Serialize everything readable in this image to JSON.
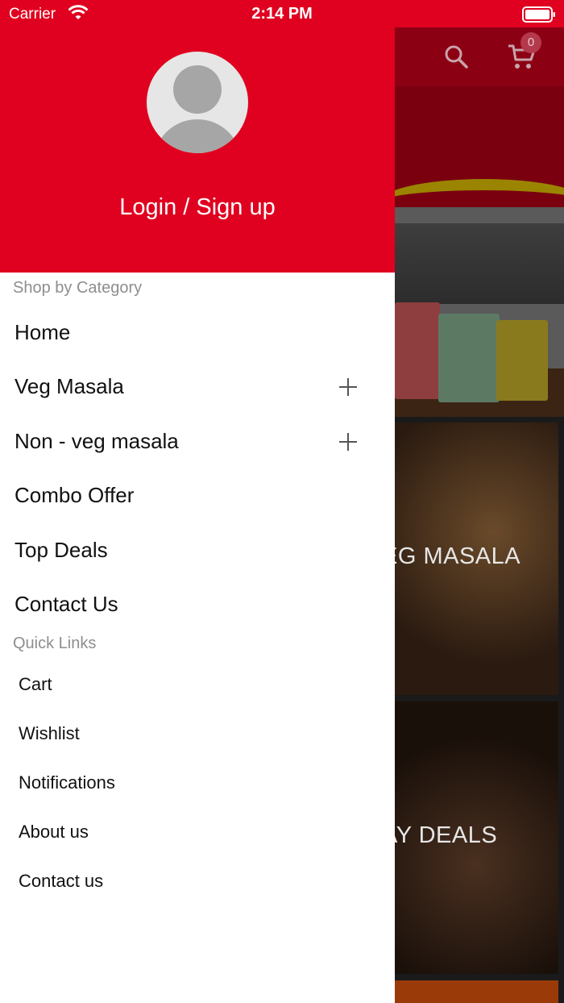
{
  "status_bar": {
    "carrier": "Carrier",
    "time": "2:14 PM"
  },
  "drawer": {
    "login_label": "Login / Sign up",
    "shop_section": "Shop by Category",
    "categories": [
      {
        "label": "Home",
        "expandable": false
      },
      {
        "label": "Veg Masala",
        "expandable": true
      },
      {
        "label": "Non - veg masala",
        "expandable": true
      },
      {
        "label": "Combo Offer",
        "expandable": false
      },
      {
        "label": "Top Deals",
        "expandable": false
      },
      {
        "label": "Contact Us",
        "expandable": false
      }
    ],
    "quick_section": "Quick Links",
    "quick_links": [
      "Cart",
      "Wishlist",
      "Notifications",
      "About us",
      "Contact us"
    ]
  },
  "background": {
    "cart_count": "0",
    "cards": [
      "EG MASALA",
      "AY DEALS"
    ]
  },
  "colors": {
    "accent": "#e0001f",
    "muted": "#8e8e8e"
  },
  "icons": [
    "wifi-icon",
    "battery-icon",
    "search-icon",
    "cart-icon",
    "avatar-icon",
    "plus-icon"
  ]
}
